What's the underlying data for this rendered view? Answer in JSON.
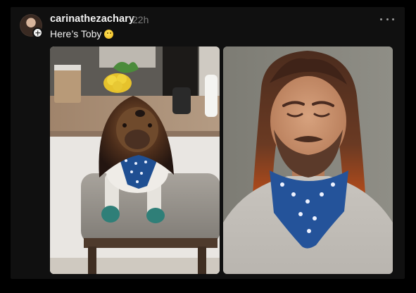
{
  "post": {
    "username": "carinathezachary",
    "timestamp": "22h",
    "caption": "Here’s Toby",
    "caption_emoji_icon": "smiling-face-emoji",
    "more_icon": "more-horizontal-icon",
    "add_icon": "add-follow-icon",
    "images": [
      {
        "subject": "dog-photo"
      },
      {
        "subject": "man-photo"
      }
    ]
  },
  "colors": {
    "background": "#000000",
    "card": "#101010",
    "text_primary": "#f3f3f3",
    "text_secondary": "#7d7d7d"
  }
}
